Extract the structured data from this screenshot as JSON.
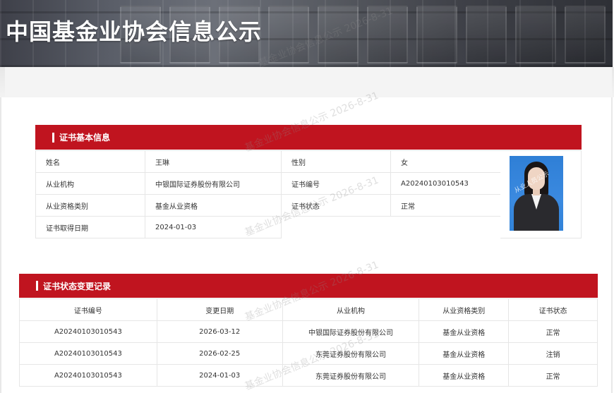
{
  "site": {
    "title": "中国基金业协会信息公示"
  },
  "watermark": "基金业协会信息公示 2026-8-31",
  "photo_watermark": "从业人员公示",
  "basic": {
    "section_title": "证书基本信息",
    "name_label": "姓名",
    "name_value": "王琳",
    "gender_label": "性别",
    "gender_value": "女",
    "org_label": "从业机构",
    "org_value": "中银国际证券股份有限公司",
    "cert_no_label": "证书编号",
    "cert_no_value": "A20240103010543",
    "qual_label": "从业资格类别",
    "qual_value": "基金从业资格",
    "status_label": "证书状态",
    "status_value": "正常",
    "date_label": "证书取得日期",
    "date_value": "2024-01-03"
  },
  "records": {
    "section_title": "证书状态变更记录",
    "columns": [
      "证书编号",
      "变更日期",
      "从业机构",
      "从业资格类别",
      "证书状态"
    ],
    "rows": [
      [
        "A20240103010543",
        "2026-03-12",
        "中银国际证券股份有限公司",
        "基金从业资格",
        "正常"
      ],
      [
        "A20240103010543",
        "2026-02-25",
        "东莞证券股份有限公司",
        "基金从业资格",
        "注销"
      ],
      [
        "A20240103010543",
        "2024-01-03",
        "东莞证券股份有限公司",
        "基金从业资格",
        "正常"
      ]
    ]
  },
  "colors": {
    "accent": "#c0141f"
  }
}
